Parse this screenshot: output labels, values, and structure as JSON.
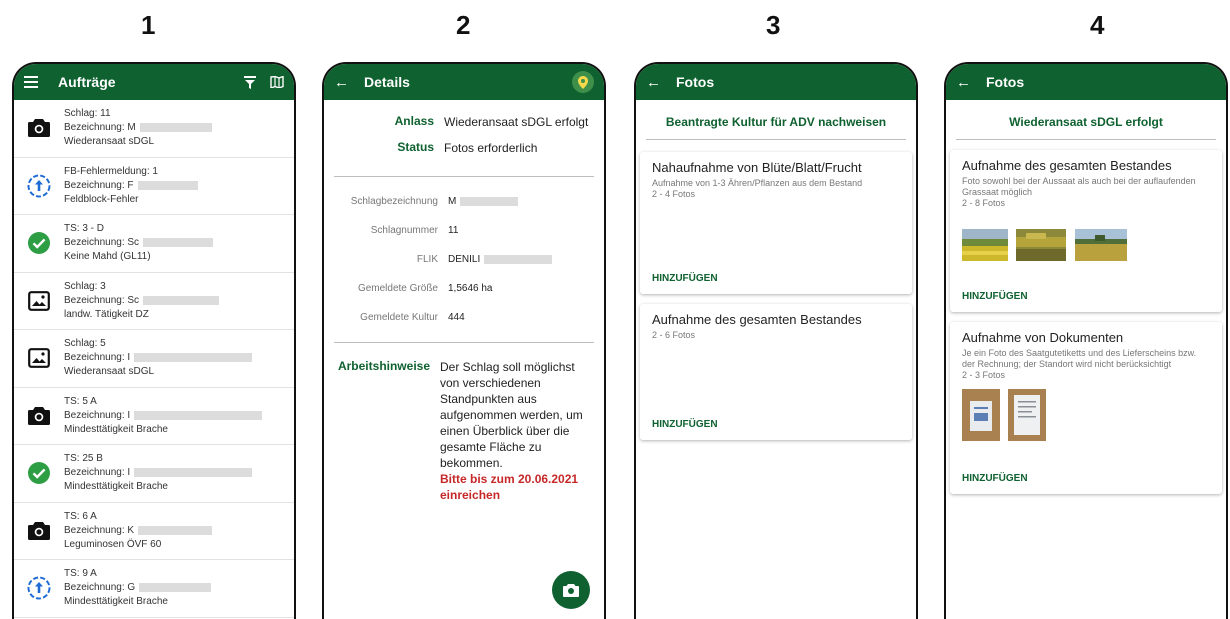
{
  "labels": [
    "1",
    "2",
    "3",
    "4"
  ],
  "phone1": {
    "title": "Aufträge",
    "orders": [
      {
        "icon": "camera-icon",
        "line1": "Schlag: 11",
        "line2": "Bezeichnung: M",
        "line3": "Wiederansaat sDGL"
      },
      {
        "icon": "upload-circle-icon",
        "line1": "FB-Fehlermeldung: 1",
        "line2": "Bezeichnung: F",
        "line3": "Feldblock-Fehler"
      },
      {
        "icon": "check-circle-icon",
        "line1": "TS: 3 - D",
        "line2": "Bezeichnung: Sc",
        "line3": "Keine Mahd (GL11)"
      },
      {
        "icon": "image-icon",
        "line1": "Schlag: 3",
        "line2": "Bezeichnung: Sc",
        "line3": "landw. Tätigkeit DZ"
      },
      {
        "icon": "image-icon",
        "line1": "Schlag: 5",
        "line2": "Bezeichnung: I",
        "line3": "Wiederansaat sDGL"
      },
      {
        "icon": "camera-icon",
        "line1": "TS: 5 A",
        "line2": "Bezeichnung: I",
        "line3": "Mindesttätigkeit Brache"
      },
      {
        "icon": "check-circle-icon",
        "line1": "TS: 25 B",
        "line2": "Bezeichnung: I",
        "line3": "Mindesttätigkeit Brache"
      },
      {
        "icon": "camera-icon",
        "line1": "TS: 6 A",
        "line2": "Bezeichnung: K",
        "line3": "Leguminosen ÖVF 60"
      },
      {
        "icon": "upload-circle-icon",
        "line1": "TS: 9 A",
        "line2": "Bezeichnung: G",
        "line3": "Mindesttätigkeit Brache"
      }
    ]
  },
  "phone2": {
    "title": "Details",
    "anlass_label": "Anlass",
    "anlass_value": "Wiederansaat sDGL erfolgt",
    "status_label": "Status",
    "status_value": "Fotos erforderlich",
    "fields": [
      {
        "label": "Schlagbezeichnung",
        "value": "M"
      },
      {
        "label": "Schlagnummer",
        "value": "11"
      },
      {
        "label": "FLIK",
        "value": "DENILI"
      },
      {
        "label": "Gemeldete Größe",
        "value": "1,5646 ha"
      },
      {
        "label": "Gemeldete Kultur",
        "value": "444"
      }
    ],
    "hint_label": "Arbeitshinweise",
    "hint_text": "Der Schlag soll möglichst von verschiedenen Standpunkten aus aufgenommen werden, um einen Überblick über die gesamte Fläche zu bekommen.",
    "hint_warning": "Bitte bis zum 20.06.2021 einreichen"
  },
  "phone3": {
    "title": "Fotos",
    "heading": "Beantragte Kultur für ADV nachweisen",
    "cards": [
      {
        "title": "Nahaufnahme von Blüte/Blatt/Frucht",
        "desc": "Aufnahme von 1-3 Ähren/Pflanzen aus dem Bestand",
        "count": "2 - 4 Fotos",
        "action": "HINZUFÜGEN"
      },
      {
        "title": "Aufnahme des gesamten Bestandes",
        "desc": "",
        "count": "2 - 6 Fotos",
        "action": "HINZUFÜGEN"
      }
    ]
  },
  "phone4": {
    "title": "Fotos",
    "heading": "Wiederansaat sDGL erfolgt",
    "cards": [
      {
        "title": "Aufnahme des gesamten Bestandes",
        "desc": "Foto sowohl bei der Aussaat als auch bei der auflaufenden Grassaat möglich",
        "count": "2 - 8 Fotos",
        "action": "HINZUFÜGEN"
      },
      {
        "title": "Aufnahme von Dokumenten",
        "desc": "Je ein Foto des Saatgutetiketts und des Lieferscheins bzw. der Rechnung; der Standort wird nicht berücksichtigt",
        "count": "2 - 3 Fotos",
        "action": "HINZUFÜGEN"
      }
    ]
  },
  "colors": {
    "brand": "#0f6130",
    "warning": "#c62828"
  }
}
